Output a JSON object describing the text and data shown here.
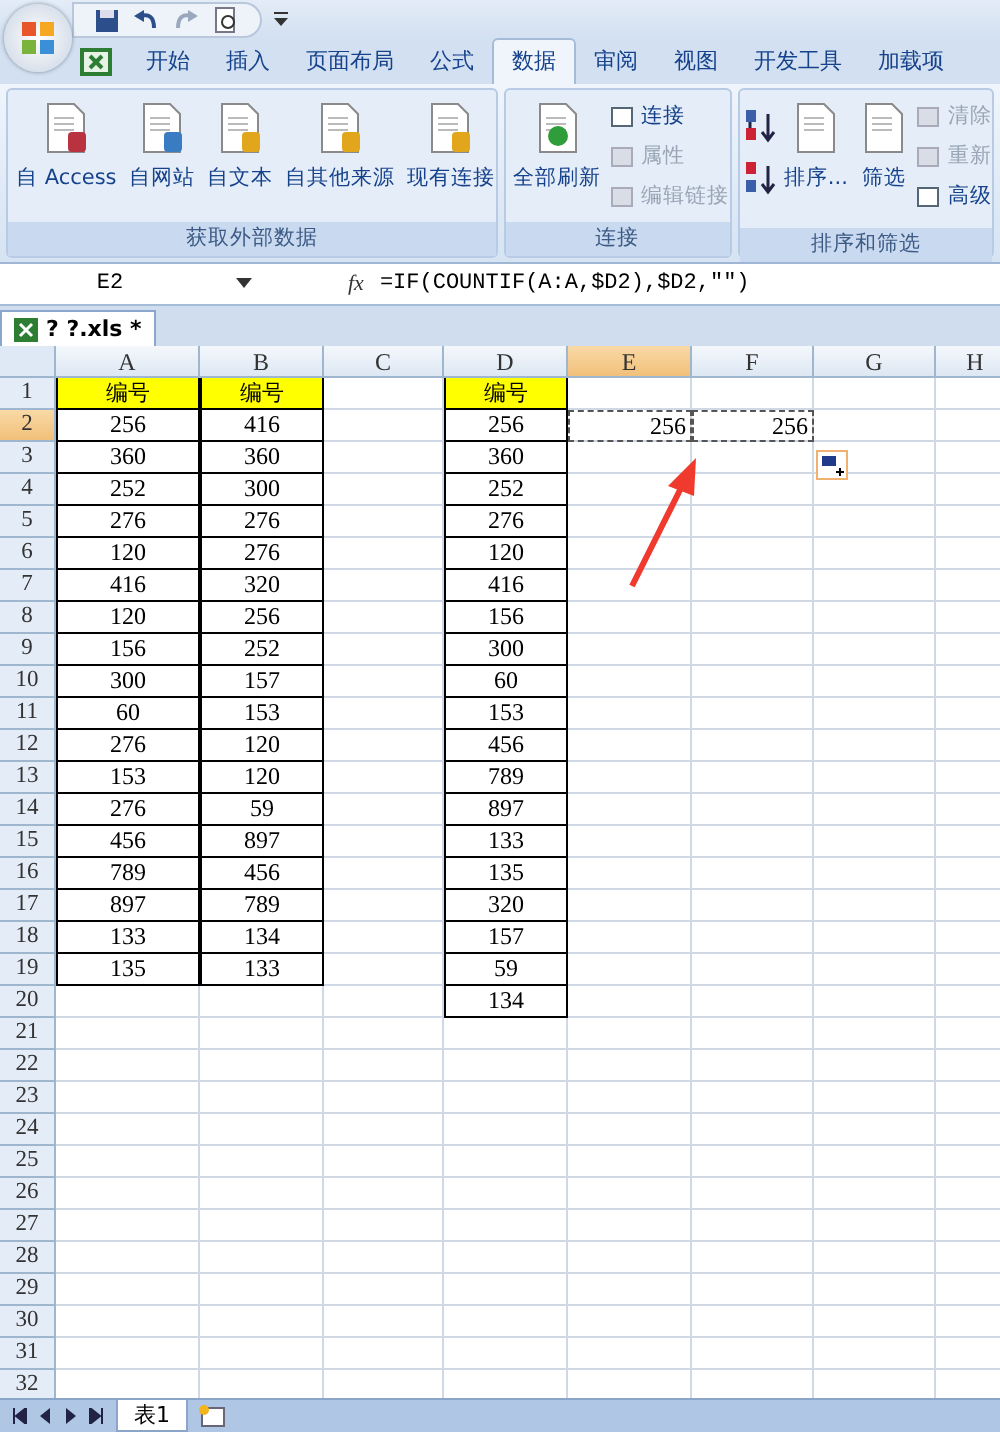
{
  "ribbon_tabs": [
    {
      "label": "开始",
      "selected": false
    },
    {
      "label": "插入",
      "selected": false
    },
    {
      "label": "页面布局",
      "selected": false
    },
    {
      "label": "公式",
      "selected": false
    },
    {
      "label": "数据",
      "selected": true
    },
    {
      "label": "审阅",
      "selected": false
    },
    {
      "label": "视图",
      "selected": false
    },
    {
      "label": "开发工具",
      "selected": false
    },
    {
      "label": "加载项",
      "selected": false
    }
  ],
  "groups": [
    {
      "title": "获取外部数据",
      "items": [
        {
          "kind": "large",
          "label": "自 Access",
          "disabled": false
        },
        {
          "kind": "large",
          "label": "自网站",
          "disabled": false
        },
        {
          "kind": "large",
          "label": "自文本",
          "disabled": false
        },
        {
          "kind": "large",
          "label": "自其他来源",
          "disabled": false
        },
        {
          "kind": "large",
          "label": "现有连接",
          "disabled": false
        }
      ]
    },
    {
      "title": "连接",
      "items": [
        {
          "kind": "large",
          "label": "全部刷新",
          "disabled": false
        },
        {
          "kind": "small",
          "label": "连接",
          "disabled": false
        },
        {
          "kind": "small",
          "label": "属性",
          "disabled": true
        },
        {
          "kind": "small",
          "label": "编辑链接",
          "disabled": true
        }
      ]
    },
    {
      "title": "排序和筛选",
      "items": [
        {
          "kind": "sort",
          "disabled": false
        },
        {
          "kind": "large",
          "label": "排序...",
          "disabled": false
        },
        {
          "kind": "large",
          "label": "筛选",
          "disabled": false
        },
        {
          "kind": "small",
          "label": "清除",
          "disabled": true
        },
        {
          "kind": "small",
          "label": "重新",
          "disabled": true
        },
        {
          "kind": "small",
          "label": "高级",
          "disabled": false
        }
      ]
    }
  ],
  "name_box": "E2",
  "function_button": "fx",
  "formula": "=IF(COUNTIF(A:A,$D2),$D2,\"\")",
  "workbook_tab": "? ?.xls *",
  "columns": [
    {
      "label": "A",
      "selected": false
    },
    {
      "label": "B",
      "selected": false
    },
    {
      "label": "C",
      "selected": false
    },
    {
      "label": "D",
      "selected": false
    },
    {
      "label": "E",
      "selected": true
    },
    {
      "label": "F",
      "selected": false
    },
    {
      "label": "G",
      "selected": false
    },
    {
      "label": "H",
      "selected": false
    }
  ],
  "rows": [
    {
      "number": "1",
      "selected": false,
      "kind": "header",
      "A": "编号",
      "B": "编号",
      "D": "编号"
    },
    {
      "number": "2",
      "selected": true,
      "copied": true,
      "A": "256",
      "B": "416",
      "D": "256",
      "E": "256",
      "F": "256"
    },
    {
      "number": "3",
      "selected": false,
      "A": "360",
      "B": "360",
      "D": "360"
    },
    {
      "number": "4",
      "selected": false,
      "A": "252",
      "B": "300",
      "D": "252"
    },
    {
      "number": "5",
      "selected": false,
      "A": "276",
      "B": "276",
      "D": "276"
    },
    {
      "number": "6",
      "selected": false,
      "A": "120",
      "B": "276",
      "D": "120"
    },
    {
      "number": "7",
      "selected": false,
      "A": "416",
      "B": "320",
      "D": "416"
    },
    {
      "number": "8",
      "selected": false,
      "A": "120",
      "B": "256",
      "D": "156"
    },
    {
      "number": "9",
      "selected": false,
      "A": "156",
      "B": "252",
      "D": "300"
    },
    {
      "number": "10",
      "selected": false,
      "A": "300",
      "B": "157",
      "D": "60"
    },
    {
      "number": "11",
      "selected": false,
      "A": "60",
      "B": "153",
      "D": "153"
    },
    {
      "number": "12",
      "selected": false,
      "A": "276",
      "B": "120",
      "D": "456"
    },
    {
      "number": "13",
      "selected": false,
      "A": "153",
      "B": "120",
      "D": "789"
    },
    {
      "number": "14",
      "selected": false,
      "A": "276",
      "B": "59",
      "D": "897"
    },
    {
      "number": "15",
      "selected": false,
      "A": "456",
      "B": "897",
      "D": "133"
    },
    {
      "number": "16",
      "selected": false,
      "A": "789",
      "B": "456",
      "D": "135"
    },
    {
      "number": "17",
      "selected": false,
      "A": "897",
      "B": "789",
      "D": "320"
    },
    {
      "number": "18",
      "selected": false,
      "A": "133",
      "B": "134",
      "D": "157"
    },
    {
      "number": "19",
      "selected": false,
      "A": "135",
      "B": "133",
      "D": "59"
    },
    {
      "number": "20",
      "selected": false,
      "D": "134"
    },
    {
      "number": "21",
      "selected": false
    },
    {
      "number": "22",
      "selected": false
    },
    {
      "number": "23",
      "selected": false
    },
    {
      "number": "24",
      "selected": false
    },
    {
      "number": "25",
      "selected": false
    },
    {
      "number": "26",
      "selected": false
    },
    {
      "number": "27",
      "selected": false
    },
    {
      "number": "28",
      "selected": false
    },
    {
      "number": "29",
      "selected": false
    },
    {
      "number": "30",
      "selected": false
    },
    {
      "number": "31",
      "selected": false
    },
    {
      "number": "32",
      "selected": false
    }
  ],
  "sheet_tabs": [
    {
      "label": "表1",
      "selected": true
    }
  ]
}
